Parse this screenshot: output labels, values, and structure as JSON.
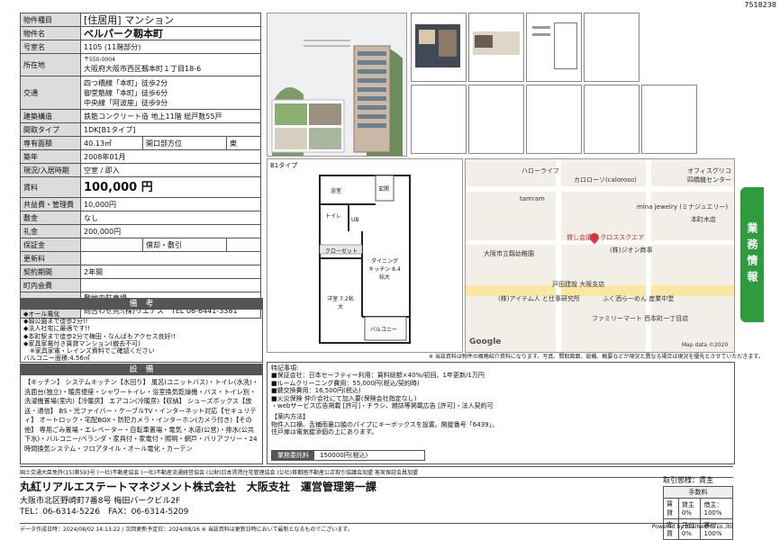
{
  "doc_id": "7518238",
  "spec": {
    "type_label": "物件種目",
    "type_value": "[住居用] マンション",
    "name_label": "物件名",
    "name_value": "ベルパーク靱本町",
    "room_label": "号室名",
    "room_value": "1105 (11階部分)",
    "addr_label": "所在地",
    "zip": "〒550-0004",
    "address": "大阪府大阪市西区靱本町１丁目18-6",
    "traffic_label": "交通",
    "traffic": [
      "四つ橋線「本町」徒歩2分",
      "御堂筋線「本町」徒歩6分",
      "中央線「阿波座」徒歩9分"
    ],
    "structure_label": "建築構造",
    "structure_value": "鉄筋コンクリート造 地上11階 総戸数55戸",
    "layout_label": "間取タイプ",
    "layout_value": "1DK[B1タイプ]",
    "area_label": "専有面積",
    "area_value": "40.13㎡",
    "direction_label": "開口部方位",
    "direction_value": "東",
    "built_label": "築年",
    "built_value": "2008年01月",
    "status_label": "現況/入居時期",
    "status_value": "空室 / 即入",
    "rent_label": "賃料",
    "rent_value": "100,000 円",
    "fee_label": "共益費・管理費",
    "fee_value": "10,000円",
    "deposit_label": "敷金",
    "deposit_value": "なし",
    "keymoney_label": "礼金",
    "keymoney_value": "200,000円",
    "guarantee_label": "保証金",
    "guarantee_mid": "償却・敷引",
    "renewal_label": "更新料",
    "contract_label": "契約期間",
    "contract_value": "2年間",
    "town_label": "町内会費",
    "parking_label": "駐車場",
    "parking_value": "敷地内駐車場",
    "parking_contact": "問合わせ先:(株)リエナス　TEL 06-6441-3381"
  },
  "remarks": {
    "title": "備　考",
    "lines": [
      "◆オール電化",
      "◆靱公園まで徒歩2分!!",
      "◆法人社宅に最適です!!",
      "◆本町駅まで徒歩2分で梅田・なんばもアクセス良好!!",
      "◆家具家電付き賃貸マンション(撤去不可)",
      "　※家具家電・レインズ資料でご確認ください",
      "バルコニー面積:4.56㎡"
    ]
  },
  "equipment": {
    "title": "設　備",
    "text": "【キッチン】 システムキッチン【水回り】 風呂(ユニットバス)・トイレ(水洗)・洗面台(独立)・暖房便座・シャワートイレ・浴室換気乾燥機・バス・トイレ別・洗濯機置場(室内)【冷暖房】 エアコン(冷暖房)【収納】 シューズボックス【放送・通信】 BS・光ファイバー・ケーブルTV・インターネット対応【セキュリティ】 オートロック・宅配BOX・防犯カメラ・インターホン(カメラ付き)【その他】 専用ごみ置場・エレベーター・自転車置場・電気・水道(公営)・排水(公共下水)・バルコニー/ベランダ・家具付・家電付・照明・網戸・バリアフリー・24時間換気システム・フロアタイル・オール電化・カーテン"
  },
  "floorplan": {
    "title": "B1タイプ",
    "labels": {
      "entrance": "玄関",
      "closet": "クローゼット",
      "dining": "ダイニング キッチン 8.4帖大",
      "western": "洋室 7.2帖大",
      "balcony": "バルコニー",
      "bath": "浴室",
      "toilet": "トイレ",
      "washroom": "UB"
    }
  },
  "map": {
    "labels": [
      "ハローライフ",
      "カロローソ(caloroso)",
      "オフィスグリコ",
      "四橋機センター",
      "tamram",
      "mina jewelry (ミナジュエリー)",
      "本町木店",
      "大阪市立靱幼稚園",
      "(株)ジオン商事",
      "貸し会議室 クロススクエア",
      "戸田建設 大阪支店",
      "(株)アイテム人 と仕事研究所",
      "ふく洒ら一めん 産業中堂",
      "ファミリーマート 西本町一丁目店",
      "Google",
      "Map data ©2020"
    ]
  },
  "disclaimer": "※ 当該資料は物件の概略紹介資料になります。写真、間取図面、設備、概要などが現況と異なる場合は現況を優先とさせていただきます。",
  "notes": {
    "special_title": "特記事項:",
    "special": [
      "■保証会社：日本セーフティー利用：賃料総額×40%/初回、1年更新/1万円",
      "■ルームクリーニング費用：55,000円(税込/契約時)",
      "■鍵交換費用：16,500円(税込)",
      "■火災保険 仲介会社にて加入要(保険会社指定なし)",
      "・webサービス広告掲載 [許可]・チラシ、雑誌等掲載広告 [許可]・法人契約可"
    ],
    "guide_title": "【案内方法】",
    "guide": [
      "物件入口横、舌鋪雨裏口脇のパイプにキーボックスを設置。開錠番号「6439」。",
      "住戸扉は電気錠添個の上にあります。"
    ],
    "ad_label": "業務委託料",
    "ad_value": "150000円(税込)"
  },
  "footer": {
    "assoc": "国土交通大臣免許(15)第593号 (一社)不動産協会 (一社)不動産流通経営協会 (公財)日本賃貸住宅管理協会 (公社)首都圏不動産公正取引協議会加盟 客実保証会員加盟",
    "company": "丸紅リアルエステートマネジメント株式会社　大阪支社　運営管理第一課",
    "address": "大阪市北区野崎町7番8号 梅田パークビル2F",
    "tel": "TEL：06-6314-5226　FAX：06-6314-5209",
    "mode_label": "取引態様：賃主",
    "fee_title": "手数料",
    "fee_rows": [
      [
        "賃貸",
        "貸主 0%",
        "借主：100%"
      ],
      [
        "売買",
        "元付 0%",
        "客付：100%"
      ]
    ],
    "dates": "データ作成日時：2024/08/02 14:13:22 / 次回更新予定日：2024/08/16 ※ 当該資料は更新日時において最新となるものでございます。",
    "powered": "Powered by RealNetPro co.,ltd"
  },
  "sidebar_label": "業務情報"
}
